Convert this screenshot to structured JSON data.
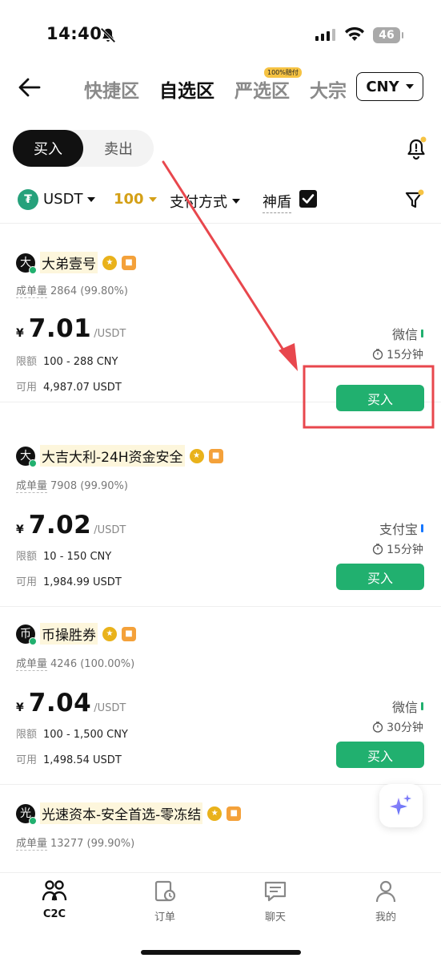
{
  "status_bar": {
    "time": "14:40",
    "battery": "46"
  },
  "nav": {
    "tabs": [
      "快捷区",
      "自选区",
      "严选区",
      "大宗"
    ],
    "active_tab": "自选区",
    "badge": "100%赔付",
    "currency": "CNY"
  },
  "trade_toggle": {
    "buy": "买入",
    "sell": "卖出"
  },
  "filters": {
    "coin": "USDT",
    "amount": "100",
    "payment": "支付方式",
    "shield": "神盾",
    "shield_checked": true
  },
  "listings": [
    {
      "avatar": "大",
      "name": "大弟壹号",
      "stats_label": "成单量",
      "stats": "2864 (99.80%)",
      "currency_symbol": "¥",
      "price": "7.01",
      "unit": "/USDT",
      "limit_label": "限额",
      "limit": "100 - 288 CNY",
      "avail_label": "可用",
      "available": "4,987.07 USDT",
      "payment": "微信",
      "payment_color": "#21b06f",
      "time_limit": "15分钟",
      "action": "买入"
    },
    {
      "avatar": "大",
      "name": "大吉大利-24H资金安全",
      "stats_label": "成单量",
      "stats": "7908 (99.90%)",
      "currency_symbol": "¥",
      "price": "7.02",
      "unit": "/USDT",
      "limit_label": "限额",
      "limit": "10 - 150 CNY",
      "avail_label": "可用",
      "available": "1,984.99 USDT",
      "payment": "支付宝",
      "payment_color": "#1677ff",
      "time_limit": "15分钟",
      "action": "买入"
    },
    {
      "avatar": "币",
      "name": "币操胜券",
      "stats_label": "成单量",
      "stats": "4246 (100.00%)",
      "currency_symbol": "¥",
      "price": "7.04",
      "unit": "/USDT",
      "limit_label": "限额",
      "limit": "100 - 1,500 CNY",
      "avail_label": "可用",
      "available": "1,498.54 USDT",
      "payment": "微信",
      "payment_color": "#21b06f",
      "time_limit": "30分钟",
      "action": "买入"
    },
    {
      "avatar": "光",
      "name": "光速资本-安全首选-零冻结",
      "stats_label": "成单量",
      "stats": "13277 (99.90%)"
    }
  ],
  "bottom_nav": [
    {
      "label": "C2C",
      "icon": "people-icon",
      "active": true
    },
    {
      "label": "订单",
      "icon": "orders-icon",
      "active": false
    },
    {
      "label": "聊天",
      "icon": "chat-icon",
      "active": false
    },
    {
      "label": "我的",
      "icon": "profile-icon",
      "active": false
    }
  ],
  "colors": {
    "accent_green": "#21b06f",
    "gold": "#d4a017",
    "annotation_red": "#e8474d"
  }
}
